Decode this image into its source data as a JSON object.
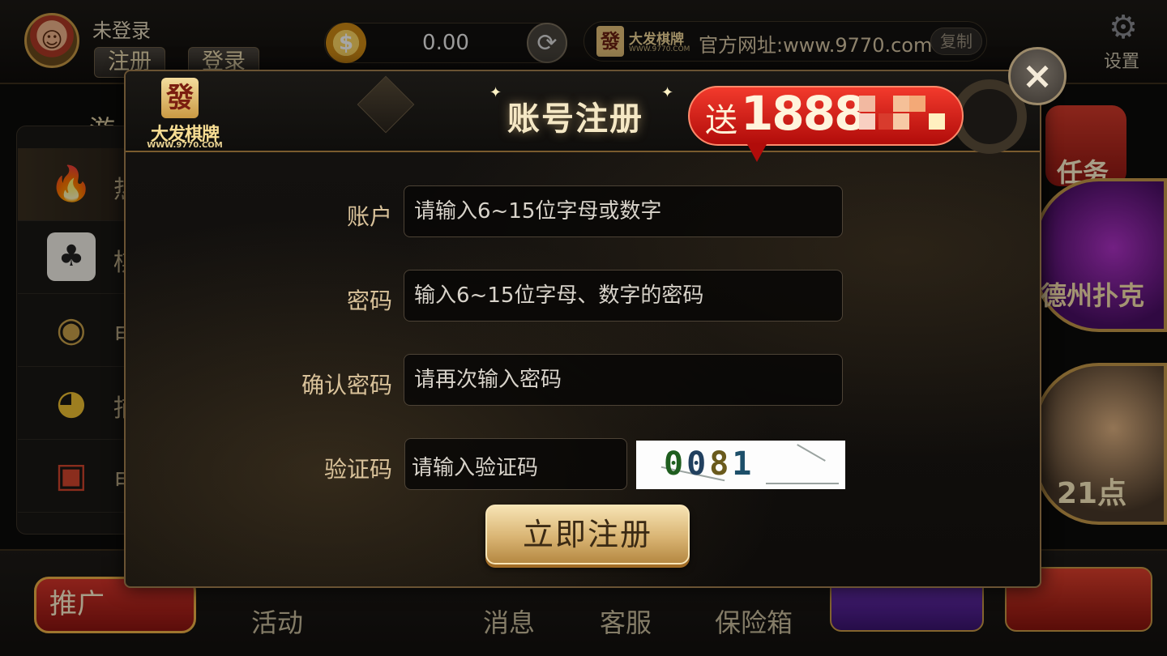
{
  "header": {
    "login_status": "未登录",
    "register_label": "注册",
    "login_label": "登录",
    "balance": "0.00",
    "brand_name": "大发棋牌",
    "brand_url": "WWW.9770.COM",
    "site_text": "官方网址:www.9770.com",
    "copy_label": "复制",
    "settings_label": "设置"
  },
  "sidebar": {
    "title": "游",
    "items": [
      {
        "icon": "hot-icon",
        "label": "热"
      },
      {
        "icon": "playing-cards-icon",
        "label": "棋"
      },
      {
        "icon": "slot-machine-icon",
        "label": "电"
      },
      {
        "icon": "fish-icon",
        "label": "捕"
      },
      {
        "icon": "jackpot-icon",
        "label": "电"
      }
    ]
  },
  "right_cards": {
    "task_label": "任务",
    "texas_label": "德州扑克",
    "blackjack_label": "21点"
  },
  "bottom_bar": {
    "promo_label": "推广",
    "activity_label": "活动",
    "message_label": "消息",
    "service_label": "客服",
    "safe_label": "保险箱"
  },
  "modal": {
    "brand_name": "大发棋牌",
    "brand_url": "WWW.9770.COM",
    "brand_glyph": "發",
    "title": "账号注册",
    "bonus_prefix": "送",
    "bonus_amount": "1888",
    "close_icon": "×",
    "fields": {
      "account_label": "账户",
      "account_placeholder": "请输入6~15位字母或数字",
      "password_label": "密码",
      "password_placeholder": "输入6~15位字母、数字的密码",
      "confirm_label": "确认密码",
      "confirm_placeholder": "请再次输入密码",
      "captcha_label": "验证码",
      "captcha_placeholder": "请输入验证码",
      "captcha_code": "0081"
    },
    "submit_label": "立即注册"
  },
  "colors": {
    "accent_gold": "#d9b473",
    "bonus_red": "#e4241b",
    "panel_dark": "#141210"
  }
}
